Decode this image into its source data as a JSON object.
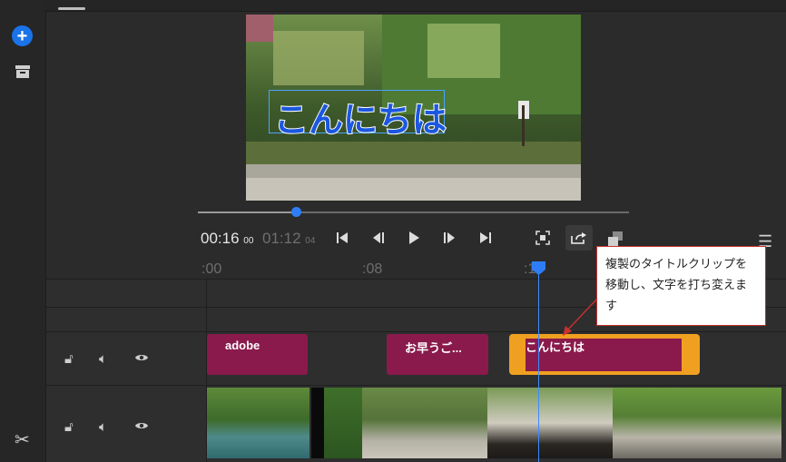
{
  "rail": {
    "add_label": "+",
    "tools": [
      "add-icon",
      "archive-icon",
      "scissors-icon"
    ]
  },
  "preview": {
    "title_overlay": "こんにちは",
    "progress": 0.23
  },
  "timecode": {
    "current": "00:16",
    "current_frames": "00",
    "total": "01:12",
    "total_frames": "04"
  },
  "controls": [
    "skip-to-start-icon",
    "step-back-icon",
    "play-icon",
    "step-forward-icon",
    "skip-to-end-icon",
    "fit-frame-icon",
    "duplicate-icon",
    "layers-icon",
    "menu-icon"
  ],
  "ruler": {
    "labels": [
      ":00",
      ":08",
      ":16"
    ]
  },
  "title_track": {
    "clips": [
      "adobe",
      "お早うご...",
      "こんにちは"
    ]
  },
  "callout": {
    "text": "複製のタイトルクリップを移動し、文字を打ち変えます"
  },
  "colors": {
    "accent": "#2f7df6",
    "title_clip": "#8a1a4c",
    "selected_border": "#f0a020",
    "callout_border": "#c9312f"
  }
}
